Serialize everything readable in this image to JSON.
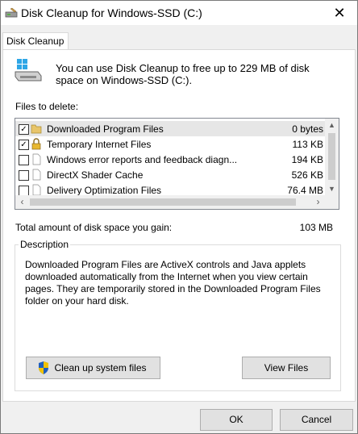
{
  "window": {
    "title": "Disk Cleanup for Windows-SSD (C:)",
    "close_glyph": "✕"
  },
  "tabs": [
    {
      "label": "Disk Cleanup",
      "selected": true
    }
  ],
  "intro": {
    "icon": "disk-cleanup-drive-icon",
    "text": "You can use Disk Cleanup to free up to 229 MB of disk space on Windows-SSD (C:)."
  },
  "files": {
    "label": "Files to delete:",
    "items": [
      {
        "name": "Downloaded Program Files",
        "size": "0 bytes",
        "checked": true,
        "selected": true,
        "icon": "folder-icon"
      },
      {
        "name": "Temporary Internet Files",
        "size": "113 KB",
        "checked": true,
        "selected": false,
        "icon": "lock-icon"
      },
      {
        "name": "Windows error reports and feedback diagn...",
        "size": "194 KB",
        "checked": false,
        "selected": false,
        "icon": "file-icon"
      },
      {
        "name": "DirectX Shader Cache",
        "size": "526 KB",
        "checked": false,
        "selected": false,
        "icon": "file-icon"
      },
      {
        "name": "Delivery Optimization Files",
        "size": "76.4 MB",
        "checked": false,
        "selected": false,
        "icon": "file-icon"
      }
    ],
    "check_glyph": "✓",
    "scroll_up": "▲",
    "scroll_down": "▼",
    "scroll_left": "‹",
    "scroll_right": "›"
  },
  "total": {
    "label": "Total amount of disk space you gain:",
    "value": "103 MB"
  },
  "description": {
    "legend": "Description",
    "text": "Downloaded Program Files are ActiveX controls and Java applets downloaded automatically from the Internet when you view certain pages. They are temporarily stored in the Downloaded Program Files folder on your hard disk."
  },
  "buttons": {
    "cleanup_system": "Clean up system files",
    "view_files": "View Files",
    "ok": "OK",
    "cancel": "Cancel"
  },
  "colors": {
    "window_bg": "#f0f0f0",
    "panel_bg": "#ffffff",
    "selected_row": "#e6e6e6",
    "button_bg": "#e1e1e1",
    "shield_blue": "#1f5fbf",
    "shield_yellow": "#f2c200"
  }
}
